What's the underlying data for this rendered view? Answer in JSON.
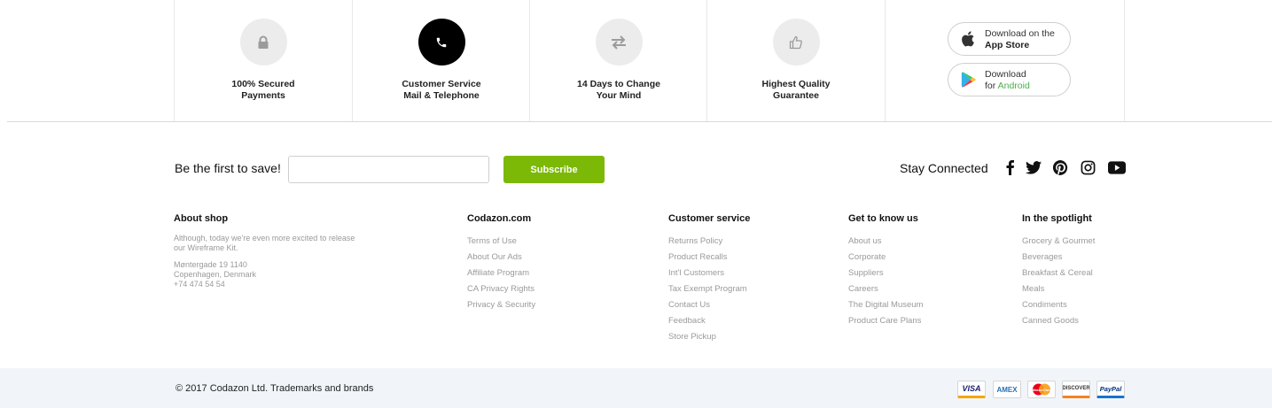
{
  "features": [
    {
      "icon": "lock-icon",
      "line1": "100% Secured",
      "line2": "Payments",
      "active": false
    },
    {
      "icon": "phone-icon",
      "line1": "Customer Service",
      "line2": "Mail & Telephone",
      "active": true
    },
    {
      "icon": "exchange-icon",
      "line1": "14 Days to Change",
      "line2": "Your Mind",
      "active": false
    },
    {
      "icon": "thumbs-up-icon",
      "line1": "Highest Quality",
      "line2": "Guarantee",
      "active": false
    }
  ],
  "apps": {
    "app_store": {
      "line1": "Download on the",
      "line2": "App Store"
    },
    "android": {
      "line1": "Download",
      "line2_prefix": "for",
      "line2_highlight": "Android"
    }
  },
  "newsletter": {
    "title": "Be the first to save!",
    "input_value": "",
    "button": "Subscribe"
  },
  "social": {
    "title": "Stay Connected",
    "icons": [
      "facebook-icon",
      "twitter-icon",
      "pinterest-icon",
      "instagram-icon",
      "youtube-icon"
    ]
  },
  "about": {
    "title": "About shop",
    "text": "Although, today we're even more excited to release our Wireframe Kit.",
    "address": [
      "Møntergade 19 1140",
      "Copenhagen, Denmark",
      "+74 474 54 54"
    ]
  },
  "columns": [
    {
      "title": "Codazon.com",
      "links": [
        "Terms of Use",
        "About Our Ads",
        "Affiliate Program",
        "CA Privacy Rights",
        "Privacy & Security"
      ]
    },
    {
      "title": "Customer service",
      "links": [
        "Returns Policy",
        "Product Recalls",
        "Int'l Customers",
        "Tax Exempt Program",
        "Contact Us",
        "Feedback",
        "Store Pickup"
      ]
    },
    {
      "title": "Get to know us",
      "links": [
        "About us",
        "Corporate",
        "Suppliers",
        "Careers",
        "The Digital Museum",
        "Product Care Plans"
      ]
    },
    {
      "title": "In the spotlight",
      "links": [
        "Grocery & Gourmet",
        "Beverages",
        "Breakfast & Cereal",
        "Meals",
        "Condiments",
        "Canned Goods"
      ]
    }
  ],
  "bottom": {
    "copyright": "© 2017 Codazon Ltd. Trademarks and brands",
    "payments": [
      "VISA",
      "AMEX",
      "MasterCard",
      "DISCOVER",
      "PayPal"
    ]
  },
  "colors": {
    "accent": "#7cb806",
    "active_circle": "#000000",
    "bottom_bg": "#f1f5f9",
    "android_green": "#4caf50"
  }
}
